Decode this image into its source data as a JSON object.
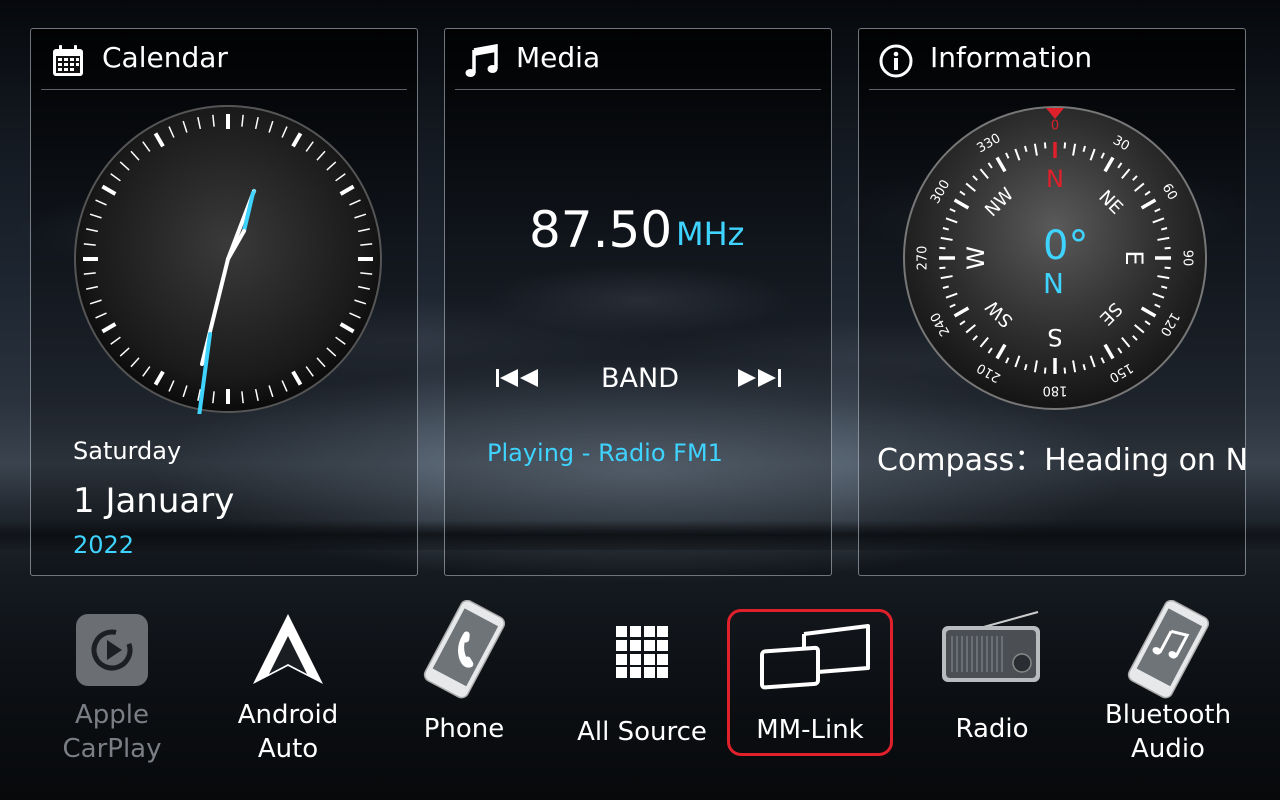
{
  "calendar": {
    "title": "Calendar",
    "day_of_week": "Saturday",
    "date": "1 January",
    "year": "2022",
    "icon": "calendar-icon"
  },
  "media": {
    "title": "Media",
    "frequency": "87.50",
    "unit": "MHz",
    "band_label": "BAND",
    "status": "Playing - Radio FM1",
    "icon": "music-note-icon"
  },
  "information": {
    "title": "Information",
    "heading_value": "0°",
    "heading_dir": "N",
    "compass_text": "Compass：Heading on N",
    "icon": "info-icon",
    "compass_labels": [
      "N",
      "NE",
      "E",
      "SE",
      "S",
      "SW",
      "W",
      "NW"
    ],
    "compass_degrees": [
      "0",
      "30",
      "60",
      "90",
      "120",
      "150",
      "180",
      "210",
      "240",
      "270",
      "300",
      "330"
    ]
  },
  "dock": {
    "items": [
      {
        "label_line1": "Apple",
        "label_line2": "CarPlay",
        "icon": "carplay-icon",
        "enabled": false
      },
      {
        "label_line1": "Android",
        "label_line2": "Auto",
        "icon": "android-auto-icon",
        "enabled": true
      },
      {
        "label_line1": "Phone",
        "icon": "phone-icon",
        "enabled": true
      },
      {
        "label_line1": "All Source",
        "icon": "grid-icon",
        "enabled": true
      },
      {
        "label_line1": "MM-Link",
        "icon": "mm-link-icon",
        "enabled": true,
        "selected": true
      },
      {
        "label_line1": "Radio",
        "icon": "radio-icon",
        "enabled": true
      },
      {
        "label_line1": "Bluetooth",
        "label_line2": "Audio",
        "icon": "bluetooth-audio-icon",
        "enabled": true
      }
    ]
  },
  "colors": {
    "accent": "#3fd3ff",
    "compass_north": "#e0202a",
    "selection": "#e0202a"
  }
}
